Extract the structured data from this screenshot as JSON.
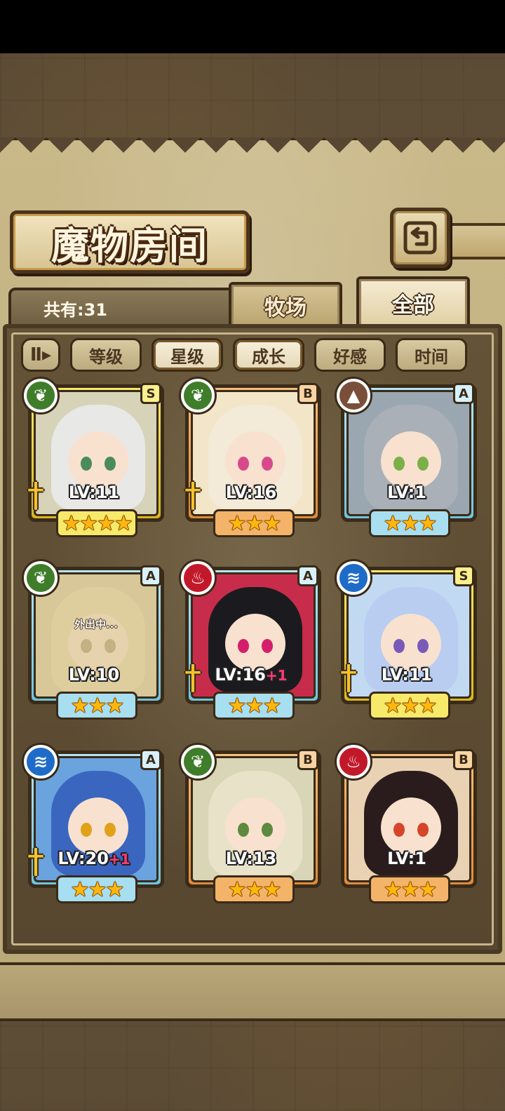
{
  "screen": {
    "title": "魔物房间",
    "count_label": "共有:31",
    "tabs": [
      {
        "label": "牧场",
        "active": false
      },
      {
        "label": "全部",
        "active": true
      }
    ],
    "sort_toggle": "Ⅱ▸",
    "sort_buttons": [
      {
        "label": "等级",
        "active": false
      },
      {
        "label": "星级",
        "active": true
      },
      {
        "label": "成长",
        "active": true
      },
      {
        "label": "好感",
        "active": false
      },
      {
        "label": "时间",
        "active": false
      }
    ]
  },
  "colors": {
    "grass": "#3f7d2b",
    "fire": "#c2192a",
    "water": "#1e6cc7",
    "earth": "#7a4f3a",
    "rarity_S": "#f7e96a",
    "rarity_A": "#a7dff0",
    "rarity_B": "#f3b46a",
    "bonus_level": "#ff3a78"
  },
  "monsters": [
    {
      "grade": "S",
      "element": "grass",
      "level": "LV:11",
      "bonus": "",
      "stars": "★★★★",
      "equipped": true,
      "away": false
    },
    {
      "grade": "B",
      "element": "grass",
      "level": "LV:16",
      "bonus": "",
      "stars": "★★★",
      "equipped": true,
      "away": false
    },
    {
      "grade": "A",
      "element": "earth",
      "level": "LV:1",
      "bonus": "",
      "stars": "★★★",
      "equipped": false,
      "away": false
    },
    {
      "grade": "A",
      "element": "grass",
      "level": "LV:10",
      "bonus": "",
      "stars": "★★★",
      "equipped": false,
      "away": true,
      "away_label": "外出中..."
    },
    {
      "grade": "A",
      "element": "fire",
      "level": "LV:16",
      "bonus": "+1",
      "stars": "★★★",
      "equipped": true,
      "away": false
    },
    {
      "grade": "S",
      "element": "water",
      "level": "LV:11",
      "bonus": "",
      "stars": "★★★",
      "equipped": true,
      "away": false
    },
    {
      "grade": "A",
      "element": "water",
      "level": "LV:20",
      "bonus": "+1",
      "stars": "★★★",
      "equipped": true,
      "away": false
    },
    {
      "grade": "B",
      "element": "grass",
      "level": "LV:13",
      "bonus": "",
      "stars": "★★★",
      "equipped": false,
      "away": false
    },
    {
      "grade": "B",
      "element": "fire",
      "level": "LV:1",
      "bonus": "",
      "stars": "★★★",
      "equipped": false,
      "away": false
    }
  ]
}
